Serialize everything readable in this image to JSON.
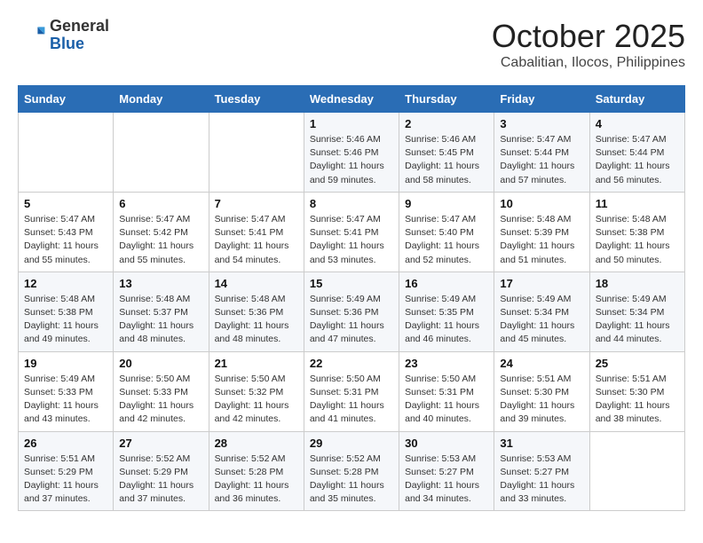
{
  "header": {
    "logo_general": "General",
    "logo_blue": "Blue",
    "month": "October 2025",
    "location": "Cabalitian, Ilocos, Philippines"
  },
  "weekdays": [
    "Sunday",
    "Monday",
    "Tuesday",
    "Wednesday",
    "Thursday",
    "Friday",
    "Saturday"
  ],
  "weeks": [
    [
      null,
      null,
      null,
      {
        "day": 1,
        "sunrise": "5:46 AM",
        "sunset": "5:46 PM",
        "daylight": "11 hours and 59 minutes."
      },
      {
        "day": 2,
        "sunrise": "5:46 AM",
        "sunset": "5:45 PM",
        "daylight": "11 hours and 58 minutes."
      },
      {
        "day": 3,
        "sunrise": "5:47 AM",
        "sunset": "5:44 PM",
        "daylight": "11 hours and 57 minutes."
      },
      {
        "day": 4,
        "sunrise": "5:47 AM",
        "sunset": "5:44 PM",
        "daylight": "11 hours and 56 minutes."
      }
    ],
    [
      {
        "day": 5,
        "sunrise": "5:47 AM",
        "sunset": "5:43 PM",
        "daylight": "11 hours and 55 minutes."
      },
      {
        "day": 6,
        "sunrise": "5:47 AM",
        "sunset": "5:42 PM",
        "daylight": "11 hours and 55 minutes."
      },
      {
        "day": 7,
        "sunrise": "5:47 AM",
        "sunset": "5:41 PM",
        "daylight": "11 hours and 54 minutes."
      },
      {
        "day": 8,
        "sunrise": "5:47 AM",
        "sunset": "5:41 PM",
        "daylight": "11 hours and 53 minutes."
      },
      {
        "day": 9,
        "sunrise": "5:47 AM",
        "sunset": "5:40 PM",
        "daylight": "11 hours and 52 minutes."
      },
      {
        "day": 10,
        "sunrise": "5:48 AM",
        "sunset": "5:39 PM",
        "daylight": "11 hours and 51 minutes."
      },
      {
        "day": 11,
        "sunrise": "5:48 AM",
        "sunset": "5:38 PM",
        "daylight": "11 hours and 50 minutes."
      }
    ],
    [
      {
        "day": 12,
        "sunrise": "5:48 AM",
        "sunset": "5:38 PM",
        "daylight": "11 hours and 49 minutes."
      },
      {
        "day": 13,
        "sunrise": "5:48 AM",
        "sunset": "5:37 PM",
        "daylight": "11 hours and 48 minutes."
      },
      {
        "day": 14,
        "sunrise": "5:48 AM",
        "sunset": "5:36 PM",
        "daylight": "11 hours and 48 minutes."
      },
      {
        "day": 15,
        "sunrise": "5:49 AM",
        "sunset": "5:36 PM",
        "daylight": "11 hours and 47 minutes."
      },
      {
        "day": 16,
        "sunrise": "5:49 AM",
        "sunset": "5:35 PM",
        "daylight": "11 hours and 46 minutes."
      },
      {
        "day": 17,
        "sunrise": "5:49 AM",
        "sunset": "5:34 PM",
        "daylight": "11 hours and 45 minutes."
      },
      {
        "day": 18,
        "sunrise": "5:49 AM",
        "sunset": "5:34 PM",
        "daylight": "11 hours and 44 minutes."
      }
    ],
    [
      {
        "day": 19,
        "sunrise": "5:49 AM",
        "sunset": "5:33 PM",
        "daylight": "11 hours and 43 minutes."
      },
      {
        "day": 20,
        "sunrise": "5:50 AM",
        "sunset": "5:33 PM",
        "daylight": "11 hours and 42 minutes."
      },
      {
        "day": 21,
        "sunrise": "5:50 AM",
        "sunset": "5:32 PM",
        "daylight": "11 hours and 42 minutes."
      },
      {
        "day": 22,
        "sunrise": "5:50 AM",
        "sunset": "5:31 PM",
        "daylight": "11 hours and 41 minutes."
      },
      {
        "day": 23,
        "sunrise": "5:50 AM",
        "sunset": "5:31 PM",
        "daylight": "11 hours and 40 minutes."
      },
      {
        "day": 24,
        "sunrise": "5:51 AM",
        "sunset": "5:30 PM",
        "daylight": "11 hours and 39 minutes."
      },
      {
        "day": 25,
        "sunrise": "5:51 AM",
        "sunset": "5:30 PM",
        "daylight": "11 hours and 38 minutes."
      }
    ],
    [
      {
        "day": 26,
        "sunrise": "5:51 AM",
        "sunset": "5:29 PM",
        "daylight": "11 hours and 37 minutes."
      },
      {
        "day": 27,
        "sunrise": "5:52 AM",
        "sunset": "5:29 PM",
        "daylight": "11 hours and 37 minutes."
      },
      {
        "day": 28,
        "sunrise": "5:52 AM",
        "sunset": "5:28 PM",
        "daylight": "11 hours and 36 minutes."
      },
      {
        "day": 29,
        "sunrise": "5:52 AM",
        "sunset": "5:28 PM",
        "daylight": "11 hours and 35 minutes."
      },
      {
        "day": 30,
        "sunrise": "5:53 AM",
        "sunset": "5:27 PM",
        "daylight": "11 hours and 34 minutes."
      },
      {
        "day": 31,
        "sunrise": "5:53 AM",
        "sunset": "5:27 PM",
        "daylight": "11 hours and 33 minutes."
      },
      null
    ]
  ]
}
